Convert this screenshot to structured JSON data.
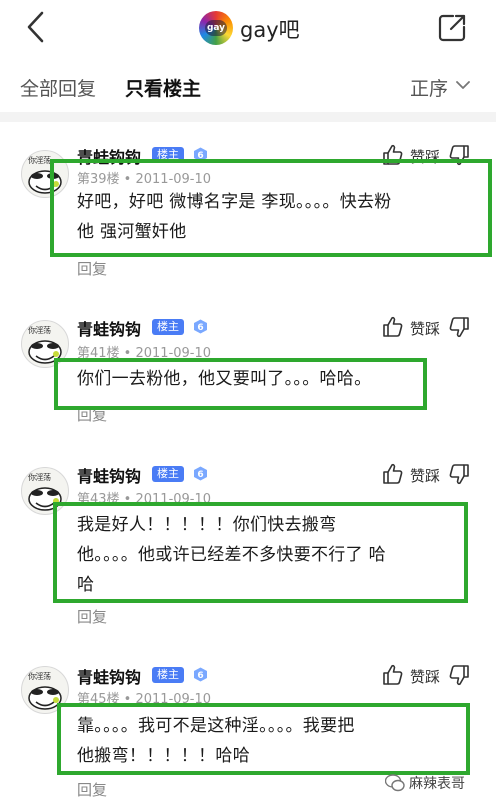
{
  "header": {
    "back_icon": "chevron-left-icon",
    "forum_logo_text": "gay",
    "forum_name": "gay吧",
    "share_icon": "share-icon"
  },
  "tabs": {
    "all_replies": "全部回复",
    "owner_only": "只看楼主",
    "sort_label": "正序",
    "sort_icon": "chevron-down-icon"
  },
  "colors": {
    "badge": "#4a7cf5",
    "highlight": "#2ea82e",
    "meta": "#999999"
  },
  "posts": [
    {
      "username": "青蛙钩钩",
      "badge": "楼主",
      "level": "6",
      "avatar_caption": "你淫荡",
      "floor": "第39楼",
      "date": "2011-09-10",
      "like_label": "赞踩",
      "reply_label": "回复",
      "content_lines": [
        "好吧，好吧 微博名字是 李现。。。。快去粉",
        "他 强河蟹奸他"
      ]
    },
    {
      "username": "青蛙钩钩",
      "badge": "楼主",
      "level": "6",
      "avatar_caption": "你淫荡",
      "floor": "第41楼",
      "date": "2011-09-10",
      "like_label": "赞踩",
      "reply_label": "回复",
      "content_lines": [
        "你们一去粉他，他又要叫了。。。哈哈。"
      ]
    },
    {
      "username": "青蛙钩钩",
      "badge": "楼主",
      "level": "6",
      "avatar_caption": "你淫荡",
      "floor": "第43楼",
      "date": "2011-09-10",
      "like_label": "赞踩",
      "reply_label": "回复",
      "content_lines": [
        "我是好人！！！！！你们快去搬弯",
        "他。。。。他或许已经差不多快要不行了 哈",
        "哈"
      ]
    },
    {
      "username": "青蛙钩钩",
      "badge": "楼主",
      "level": "6",
      "avatar_caption": "你淫荡",
      "floor": "第45楼",
      "date": "2011-09-10",
      "like_label": "赞踩",
      "reply_label": "回复",
      "content_lines": [
        "靠。。。。我可不是这种淫。。。。我要把",
        "他搬弯！！！！！哈哈"
      ]
    }
  ],
  "watermark": {
    "text": "麻辣表哥"
  }
}
